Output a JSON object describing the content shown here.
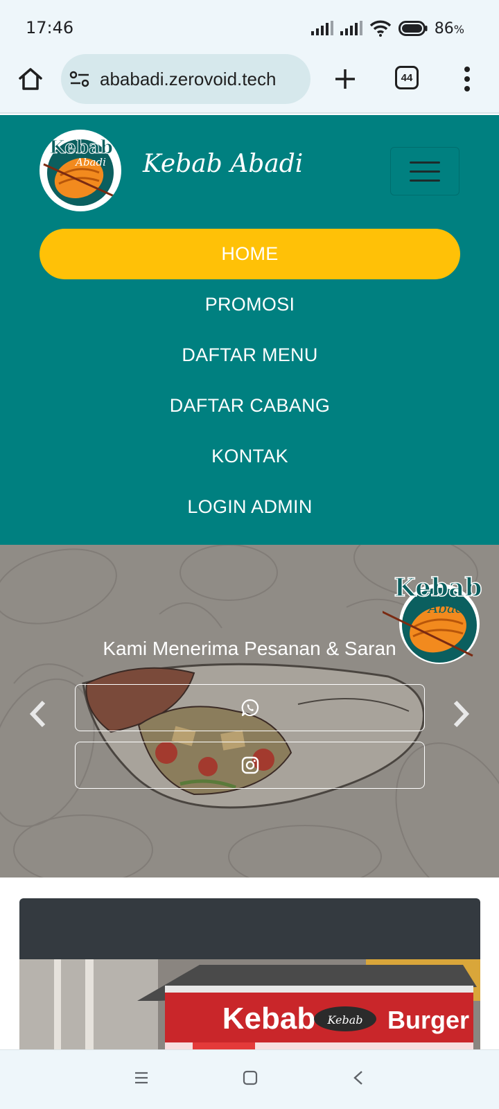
{
  "status_bar": {
    "time": "17:46",
    "battery": "86",
    "battery_unit": "%"
  },
  "browser": {
    "url": "ababadi.zerovoid.tech",
    "tab_count": "44"
  },
  "navbar": {
    "brand": "Kebab Abadi",
    "logo_text": "Kebab Abadi",
    "items": [
      {
        "label": "HOME",
        "active": true
      },
      {
        "label": "PROMOSI",
        "active": false
      },
      {
        "label": "DAFTAR MENU",
        "active": false
      },
      {
        "label": "DAFTAR CABANG",
        "active": false
      },
      {
        "label": "KONTAK",
        "active": false
      },
      {
        "label": "LOGIN ADMIN",
        "active": false
      }
    ]
  },
  "hero": {
    "title": "Kami Menerima Pesanan & Saran",
    "buttons": [
      {
        "icon": "whatsapp-icon"
      },
      {
        "icon": "instagram-icon"
      }
    ]
  },
  "card_photo_sign": {
    "main": "Kebab",
    "badge": "Kebab",
    "right": "Burger"
  },
  "colors": {
    "navbar": "#008080",
    "active_pill": "#ffc107",
    "card_header": "#343a40",
    "chrome": "#eef6fa"
  }
}
